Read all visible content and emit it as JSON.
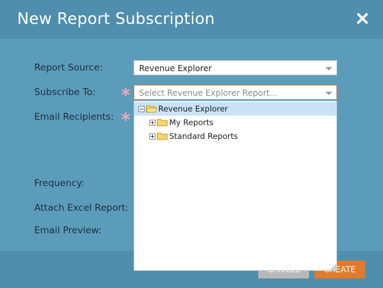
{
  "dialog": {
    "title": "New Report Subscription"
  },
  "form": {
    "report_source_label": "Report Source:",
    "subscribe_to_label": "Subscribe To:",
    "email_recipients_label": "Email Recipients:",
    "frequency_label": "Frequency:",
    "attach_excel_label": "Attach Excel Report:",
    "email_preview_label": "Email Preview:",
    "report_source_value": "Revenue Explorer",
    "subscribe_to_placeholder": "Select Revenue Explorer Report..."
  },
  "tree": {
    "root": "Revenue Explorer",
    "children": [
      "My Reports",
      "Standard Reports"
    ]
  },
  "footer": {
    "cancel_label": "CANCEL",
    "create_label": "CREATE"
  },
  "colors": {
    "accent": "#e27a2c",
    "header": "#4f8eae",
    "body": "#5b9cbb",
    "required": "#f0a0b0"
  }
}
